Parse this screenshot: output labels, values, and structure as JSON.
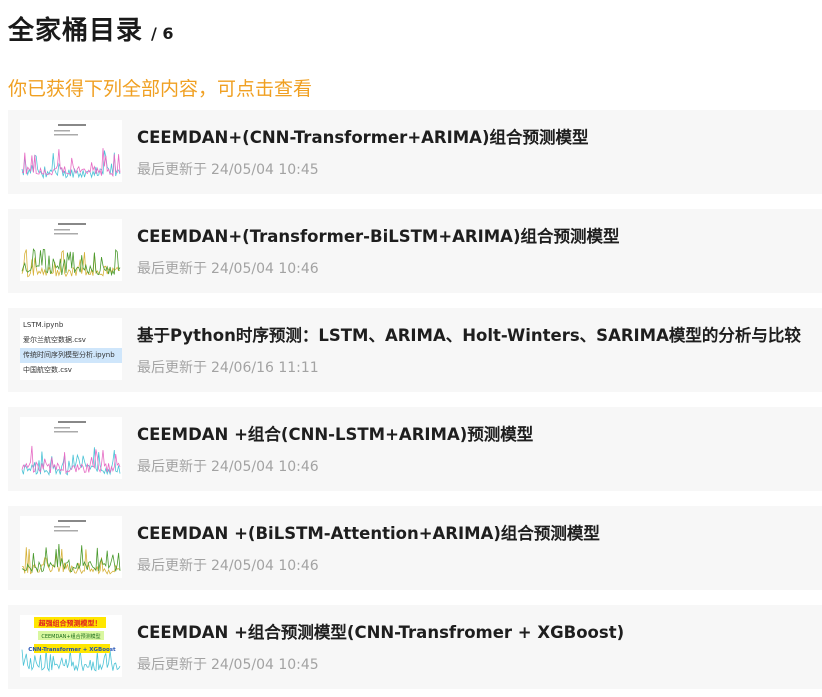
{
  "header": {
    "title": "全家桶目录",
    "count": "/ 6"
  },
  "subtitle": "你已获得下列全部内容，可点击查看",
  "meta_prefix": "最后更新于",
  "colors": {
    "accent": "#f0a022",
    "line_pink": "#e66cc4",
    "line_cyan": "#4cc3d6",
    "line_green": "#4a9a2e",
    "line_gold": "#d6b23a"
  },
  "items": [
    {
      "title": "CEEMDAN+(CNN-Transformer+ARIMA)组合预测模型",
      "date": "24/05/04 10:45",
      "thumb": "pink-cyan-chart"
    },
    {
      "title": "CEEMDAN+(Transformer-BiLSTM+ARIMA)组合预测模型",
      "date": "24/05/04 10:46",
      "thumb": "green-gold-chart"
    },
    {
      "title": "基于Python时序预测：LSTM、ARIMA、Holt-Winters、SARIMA模型的分析与比较",
      "date": "24/06/16 11:11",
      "thumb": "file-list",
      "files": [
        "LSTM.ipynb",
        "爱尔兰航空数据.csv",
        "传统时间序列模型分析.ipynb",
        "中国航空数.csv"
      ]
    },
    {
      "title": "CEEMDAN +组合(CNN-LSTM+ARIMA)预测模型",
      "date": "24/05/04 10:46",
      "thumb": "pink-cyan-chart"
    },
    {
      "title": "CEEMDAN +(BiLSTM-Attention+ARIMA)组合预测模型",
      "date": "24/05/04 10:46",
      "thumb": "green-gold-chart"
    },
    {
      "title": "CEEMDAN +组合预测模型(CNN-Transfromer + XGBoost)",
      "date": "24/05/04 10:45",
      "thumb": "promo-chart",
      "promo": [
        "超强组合预测模型！",
        "CEEMDAN+组合预测模型",
        "CNN-Transformer + XGBoost"
      ]
    }
  ]
}
